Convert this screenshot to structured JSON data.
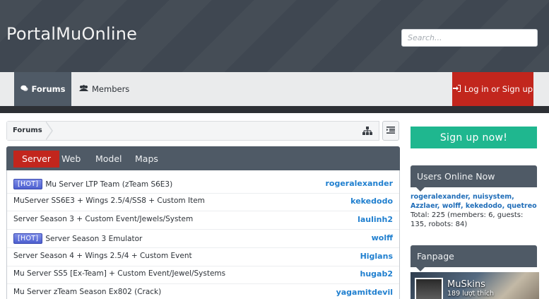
{
  "header": {
    "logo": "PortalMuOnline",
    "search_placeholder": "Search..."
  },
  "nav": {
    "forums": "Forums",
    "members": "Members",
    "login": "Log in or Sign up"
  },
  "breadcrumb": {
    "label": "Forums"
  },
  "tabs": [
    "Server",
    "Web",
    "Model",
    "Maps"
  ],
  "hot_label": "[HOT]",
  "threads": [
    {
      "hot": true,
      "title": "Mu Server LTP Team (zTeam S6E3)",
      "user": "rogeralexander"
    },
    {
      "hot": false,
      "title": "MuServer SS6E3 + Wings 2.5/4/SS8 + Custom Item",
      "user": "kekedodo"
    },
    {
      "hot": false,
      "title": "Server Season 3 + Custom Event/Jewels/System",
      "user": "laulinh2"
    },
    {
      "hot": true,
      "title": "Server Season 3 Emulator",
      "user": "wolff"
    },
    {
      "hot": false,
      "title": "Server Season 4 + Wings 2.5/4 + Custom Event",
      "user": "Higlans"
    },
    {
      "hot": false,
      "title": "Mu Server SS5 [Ex-Team] + Custom Event/Jewel/Systems",
      "user": "hugab2"
    },
    {
      "hot": false,
      "title": "Mu Server zTeam Season Ex802 (Crack)",
      "user": "yagamitdevil"
    }
  ],
  "sidebar": {
    "signup": "Sign up now!",
    "users_online_title": "Users Online Now",
    "users_online_names": "rogeralexander, nuisystem, Azzlaer, wolff, kekedodo, quetreo",
    "users_online_total": "Total: 225 (members: 6, guests: 135, robots: 84)",
    "fanpage_title": "Fanpage",
    "fanpage_name": "MuSkins",
    "fanpage_likes": "189 lượt thích"
  },
  "colors": {
    "header_bg": "#3f4751",
    "accent_red": "#c2261d",
    "signup_green": "#1fb78f",
    "panel_slate": "#4f5a66",
    "link_blue": "#1f7fcf"
  }
}
